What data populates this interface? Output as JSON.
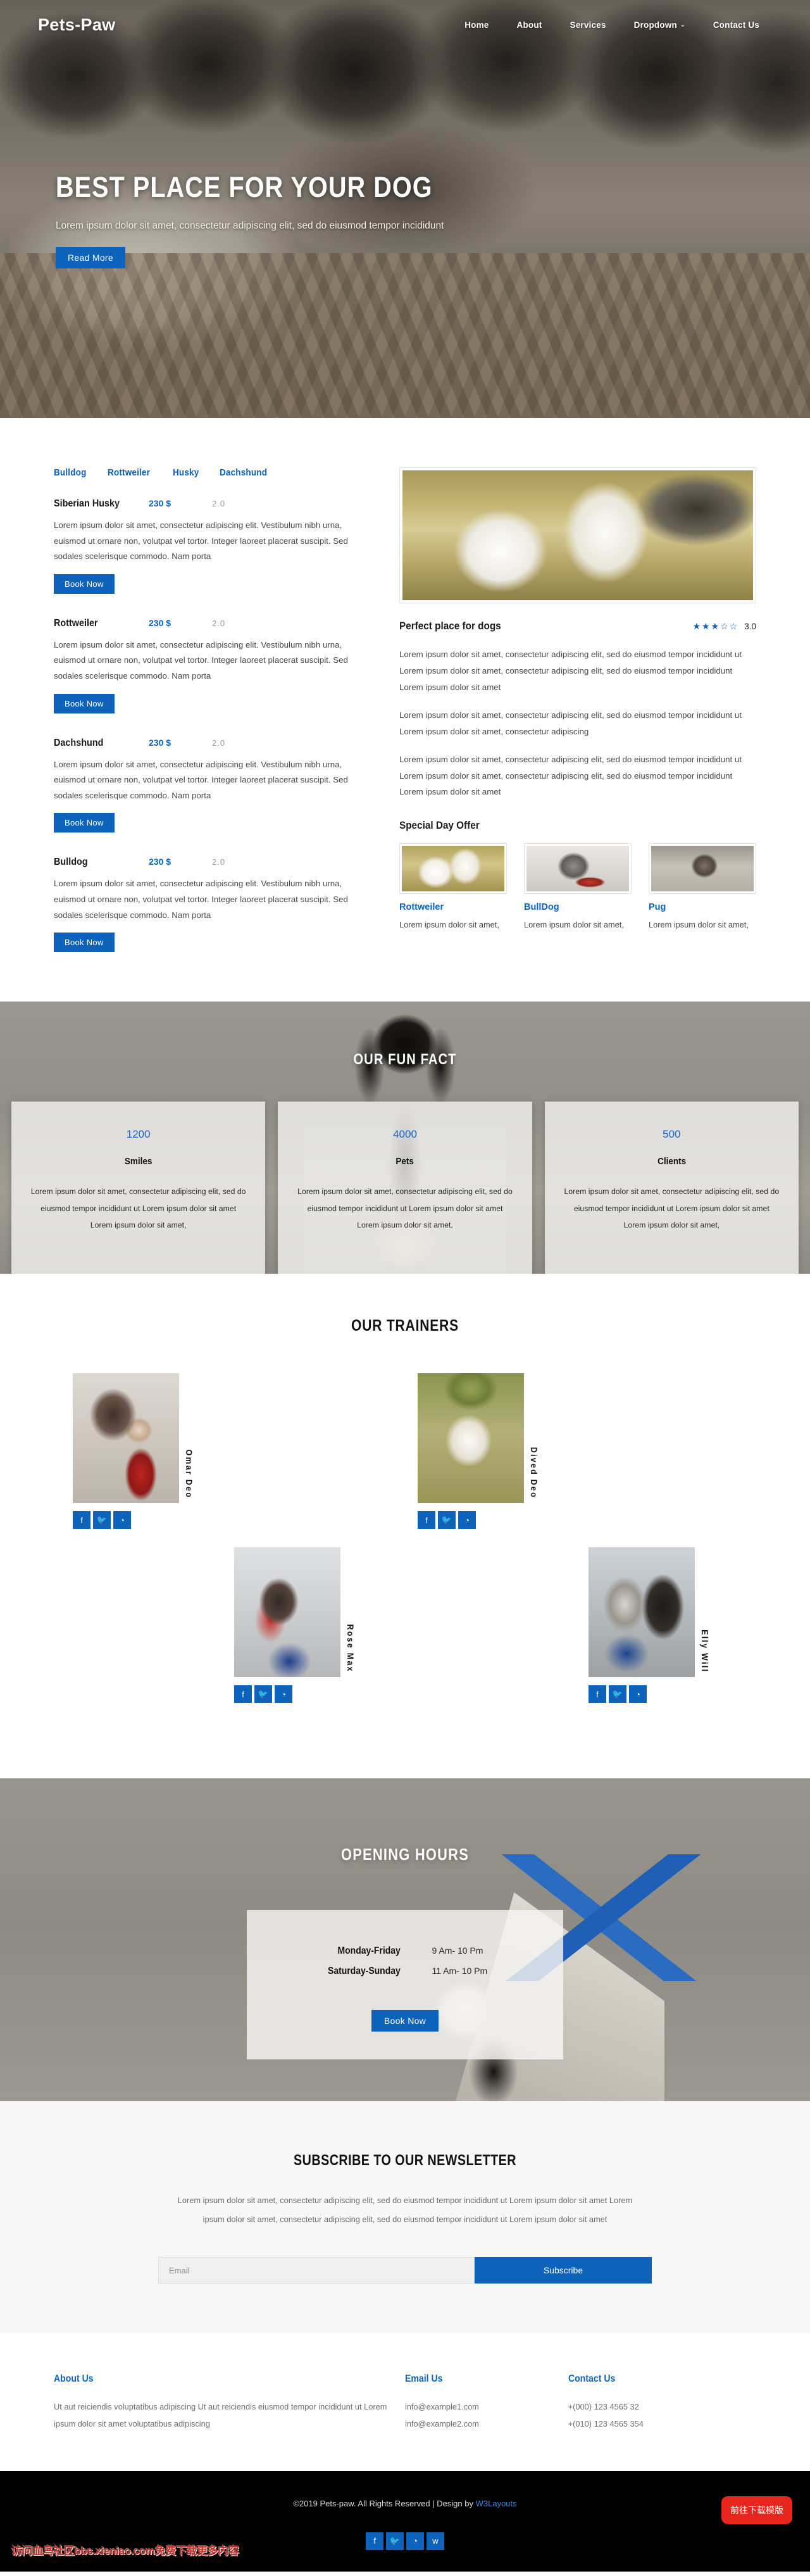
{
  "brand": "Pets-Paw",
  "nav": {
    "items": [
      {
        "label": "Home"
      },
      {
        "label": "About"
      },
      {
        "label": "Services"
      },
      {
        "label": "Dropdown",
        "caret": "⌄"
      },
      {
        "label": "Contact Us"
      }
    ]
  },
  "hero": {
    "title": "BEST PLACE FOR YOUR DOG",
    "subtitle": "Lorem ipsum dolor sit amet, consectetur adipiscing elit, sed do eiusmod tempor incididunt",
    "cta": "Read More"
  },
  "breeds": {
    "tabs": [
      "Bulldog",
      "Rottweiler",
      "Husky",
      "Dachshund"
    ],
    "items": [
      {
        "name": "Siberian Husky",
        "price": "230 $",
        "rating": "2.0",
        "desc": "Lorem ipsum dolor sit amet, consectetur adipiscing elit. Vestibulum nibh urna, euismod ut ornare non, volutpat vel tortor. Integer laoreet placerat suscipit. Sed sodales scelerisque commodo. Nam porta",
        "cta": "Book Now"
      },
      {
        "name": "Rottweiler",
        "price": "230 $",
        "rating": "2.0",
        "desc": "Lorem ipsum dolor sit amet, consectetur adipiscing elit. Vestibulum nibh urna, euismod ut ornare non, volutpat vel tortor. Integer laoreet placerat suscipit. Sed sodales scelerisque commodo. Nam porta",
        "cta": "Book Now"
      },
      {
        "name": "Dachshund",
        "price": "230 $",
        "rating": "2.0",
        "desc": "Lorem ipsum dolor sit amet, consectetur adipiscing elit. Vestibulum nibh urna, euismod ut ornare non, volutpat vel tortor. Integer laoreet placerat suscipit. Sed sodales scelerisque commodo. Nam porta",
        "cta": "Book Now"
      },
      {
        "name": "Bulldog",
        "price": "230 $",
        "rating": "2.0",
        "desc": "Lorem ipsum dolor sit amet, consectetur adipiscing elit. Vestibulum nibh urna, euismod ut ornare non, volutpat vel tortor. Integer laoreet placerat suscipit. Sed sodales scelerisque commodo. Nam porta",
        "cta": "Book Now"
      }
    ]
  },
  "perfect": {
    "title": "Perfect place for dogs",
    "stars": "★★★☆☆",
    "rating": "3.0",
    "paragraphs": [
      "Lorem ipsum dolor sit amet, consectetur adipiscing elit, sed do eiusmod tempor incididunt ut Lorem ipsum dolor sit amet, consectetur adipiscing elit, sed do eiusmod tempor incididunt Lorem ipsum dolor sit amet",
      "Lorem ipsum dolor sit amet, consectetur adipiscing elit, sed do eiusmod tempor incididunt ut Lorem ipsum dolor sit amet, consectetur adipiscing",
      "Lorem ipsum dolor sit amet, consectetur adipiscing elit, sed do eiusmod tempor incididunt ut Lorem ipsum dolor sit amet, consectetur adipiscing elit, sed do eiusmod tempor incididunt Lorem ipsum dolor sit amet"
    ]
  },
  "special": {
    "title": "Special Day Offer",
    "offers": [
      {
        "name": "Rottweiler",
        "desc": "Lorem ipsum dolor sit amet,"
      },
      {
        "name": "BullDog",
        "desc": "Lorem ipsum dolor sit amet,"
      },
      {
        "name": "Pug",
        "desc": "Lorem ipsum dolor sit amet,"
      }
    ]
  },
  "funfact": {
    "title": "OUR FUN FACT",
    "cards": [
      {
        "number": "1200",
        "label": "Smiles",
        "text": "Lorem ipsum dolor sit amet, consectetur adipiscing elit, sed do eiusmod tempor incididunt ut Lorem ipsum dolor sit amet Lorem ipsum dolor sit amet,"
      },
      {
        "number": "4000",
        "label": "Pets",
        "text": "Lorem ipsum dolor sit amet, consectetur adipiscing elit, sed do eiusmod tempor incididunt ut Lorem ipsum dolor sit amet Lorem ipsum dolor sit amet,"
      },
      {
        "number": "500",
        "label": "Clients",
        "text": "Lorem ipsum dolor sit amet, consectetur adipiscing elit, sed do eiusmod tempor incididunt ut Lorem ipsum dolor sit amet Lorem ipsum dolor sit amet,"
      }
    ]
  },
  "trainers": {
    "title": "OUR TRAINERS",
    "people": [
      {
        "name": "Omar Deo"
      },
      {
        "name": "Dived Deo"
      },
      {
        "name": "Rose Max"
      },
      {
        "name": "Elly Will"
      }
    ],
    "social": [
      "f",
      "🐦",
      "◔"
    ]
  },
  "opening": {
    "title": "OPENING HOURS",
    "rows": [
      {
        "day": "Monday-Friday",
        "time": "9 Am- 10 Pm"
      },
      {
        "day": "Saturday-Sunday",
        "time": "11 Am- 10 Pm"
      }
    ],
    "cta": "Book Now"
  },
  "newsletter": {
    "title": "SUBSCRIBE TO OUR NEWSLETTER",
    "text": "Lorem ipsum dolor sit amet, consectetur adipiscing elit, sed do eiusmod tempor incididunt ut Lorem ipsum dolor sit amet Lorem ipsum dolor sit amet, consectetur adipiscing elit, sed do eiusmod tempor incididunt ut Lorem ipsum dolor sit amet",
    "placeholder": "Email",
    "submit": "Subscribe"
  },
  "footer": {
    "about": {
      "heading": "About Us",
      "text": "Ut aut reiciendis voluptatibus adipiscing Ut aut reiciendis eiusmod tempor incididunt ut Lorem ipsum dolor sit amet voluptatibus adipiscing"
    },
    "email": {
      "heading": "Email Us",
      "items": [
        "info@example1.com",
        "info@example2.com"
      ]
    },
    "contact": {
      "heading": "Contact Us",
      "items": [
        "+(000) 123 4565 32",
        "+(010) 123 4565 354"
      ]
    }
  },
  "copyright": {
    "prefix": "©2019 Pets-paw. All Rights Reserved | Design by ",
    "link": "W3Layouts",
    "download_button": "前往下载模版",
    "watermark": "访问血鸟社区bbs.xieniao.com免费下载更多内容",
    "social": [
      "f",
      "🐦",
      "◔",
      "w"
    ]
  },
  "colors": {
    "accent": "#0d62bb",
    "red": "#e8261d",
    "dark": "#000000"
  }
}
